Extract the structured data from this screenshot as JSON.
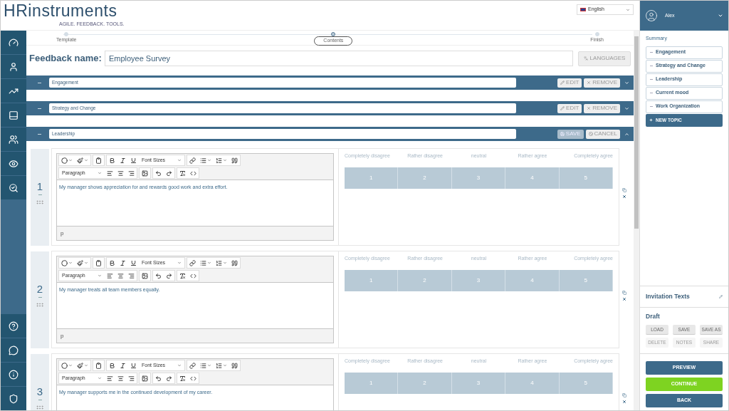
{
  "logo": {
    "name": "HRinstruments",
    "tagline": "AGILE. FEEDBACK. TOOLS."
  },
  "language_select": {
    "value": "English"
  },
  "user": {
    "name": "Alex"
  },
  "stepper": [
    {
      "label": "Template",
      "selected": false
    },
    {
      "label": "Contents",
      "selected": true
    },
    {
      "label": "Finish",
      "selected": false
    }
  ],
  "feedback_name": {
    "label": "Feedback name:",
    "value": "Employee Survey"
  },
  "languages_button": "LANGUAGES",
  "topics": [
    {
      "title": "Engagement",
      "editing": false,
      "expanded": false,
      "buttons": [
        "EDIT",
        "REMOVE"
      ]
    },
    {
      "title": "Strategy and Change",
      "editing": false,
      "expanded": false,
      "buttons": [
        "EDIT",
        "REMOVE"
      ]
    },
    {
      "title": "Leadership",
      "editing": true,
      "expanded": true,
      "buttons": [
        "SAVE",
        "CANCEL"
      ]
    }
  ],
  "questions": [
    {
      "number": "1",
      "text": "My manager shows appreciation for and rewards good work and extra effort.",
      "font_sizes": "Font Sizes",
      "format": "Paragraph",
      "path": "p",
      "scale_labels": [
        "Completely disagree",
        "Rather disagree",
        "neutral",
        "Rather agree",
        "Completely agree"
      ],
      "scale_values": [
        "1",
        "2",
        "3",
        "4",
        "5"
      ]
    },
    {
      "number": "2",
      "text": "My manager treats all team members equally.",
      "font_sizes": "Font Sizes",
      "format": "Paragraph",
      "path": "p",
      "scale_labels": [
        "Completely disagree",
        "Rather disagree",
        "neutral",
        "Rather agree",
        "Completely agree"
      ],
      "scale_values": [
        "1",
        "2",
        "3",
        "4",
        "5"
      ]
    },
    {
      "number": "3",
      "text": "My manager supports me in the continued development of my career.",
      "font_sizes": "Font Sizes",
      "format": "Paragraph",
      "scale_labels": [
        "Completely disagree",
        "Rather disagree",
        "neutral",
        "Rather agree",
        "Completely agree"
      ],
      "scale_values": [
        "1",
        "2",
        "3",
        "4",
        "5"
      ]
    }
  ],
  "summary": {
    "title": "Summary",
    "items": [
      "Engagement",
      "Strategy and Change",
      "Leadership",
      "Current mood",
      "Work Organization"
    ],
    "new_topic": "NEW TOPIC"
  },
  "invitation_texts": "Invitation Texts",
  "draft": {
    "title": "Draft",
    "buttons": [
      {
        "label": "LOAD",
        "disabled": false
      },
      {
        "label": "SAVE",
        "disabled": false
      },
      {
        "label": "SAVE AS",
        "disabled": false
      },
      {
        "label": "DELETE",
        "disabled": true
      },
      {
        "label": "NOTES",
        "disabled": true
      },
      {
        "label": "SHARE",
        "disabled": true
      }
    ]
  },
  "actions": [
    {
      "label": "PREVIEW",
      "kind": "secondary"
    },
    {
      "label": "CONTINUE",
      "kind": "primary"
    },
    {
      "label": "BACK",
      "kind": "secondary"
    }
  ]
}
